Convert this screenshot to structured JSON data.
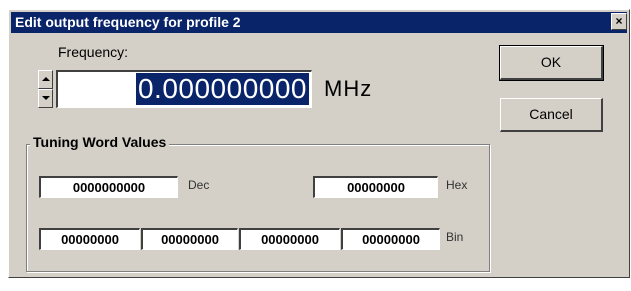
{
  "window": {
    "title": "Edit output frequency for profile 2",
    "close_glyph": "×"
  },
  "frequency": {
    "label": "Frequency:",
    "value": "0.000000000",
    "unit": "MHz"
  },
  "buttons": {
    "ok_label": "OK",
    "cancel_label": "Cancel"
  },
  "tuning": {
    "group_title": "Tuning Word Values",
    "dec_value": "0000000000",
    "dec_label": "Dec",
    "hex_value": "00000000",
    "hex_label": "Hex",
    "bin_values": [
      "00000000",
      "00000000",
      "00000000",
      "00000000"
    ],
    "bin_label": "Bin"
  },
  "colors": {
    "titlebar": "#0a246a",
    "dialog_face": "#d4d0c8",
    "selection": "#0a246a"
  },
  "icons": {
    "spin_up": "spin-up-arrow-icon",
    "spin_down": "spin-down-arrow-icon",
    "close": "close-icon"
  }
}
